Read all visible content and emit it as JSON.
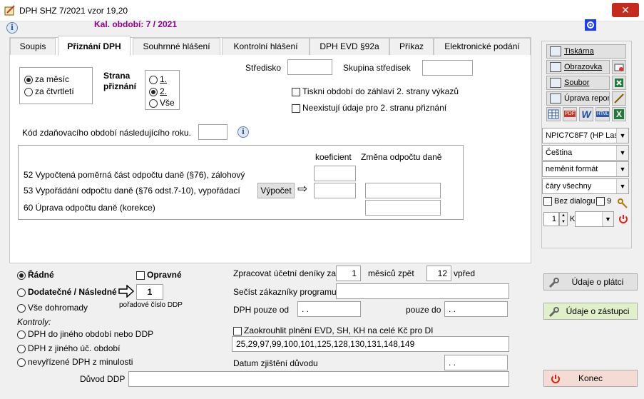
{
  "window": {
    "title": "DPH SHZ  7/2021 vzor 19,20",
    "close_glyph": "✕",
    "period": "Kal. období: 7 / 2021"
  },
  "tabs": [
    {
      "label": "Soupis"
    },
    {
      "label": "Přiznání DPH"
    },
    {
      "label": "Souhrnné hlášení"
    },
    {
      "label": "Kontrolní hlášení"
    },
    {
      "label": "DPH EVD §92a"
    },
    {
      "label": "Příkaz"
    },
    {
      "label": "Elektronické podání"
    }
  ],
  "period_type": {
    "monthly": "za měsíc",
    "quarterly": "za čtvrtletí"
  },
  "strana": {
    "title_1": "Strana",
    "title_2": "přiznání",
    "opt1": "1.",
    "opt2": "2.",
    "opt_all": "Vše"
  },
  "stredisko": {
    "label": "Středisko",
    "value": ""
  },
  "skupina": {
    "label": "Skupina středisek",
    "value": ""
  },
  "checks": {
    "tiskni": "Tiskni období do záhlaví 2. strany výkazů",
    "neexistuji": "Neexistují údaje pro 2. stranu přiznání"
  },
  "kod": {
    "label": "Kód zdaňovacího období následujícího roku.",
    "value": ""
  },
  "odpocet": {
    "col_koef": "koeficient",
    "col_zmena": "Změna odpočtu daně",
    "row52": "52 Vypočtená poměrná část odpočtu daně (§76), zálohový",
    "row53": "53 Vypořádání odpočtu daně (§76 odst.7-10), vypořádací",
    "row60": "60 Úprava odpočtu daně (korekce)",
    "vypocet": "Výpočet",
    "arrow": "⇨"
  },
  "side": {
    "tiskarna": "Tiskárna",
    "obrazovka": "Obrazovka",
    "soubor": "Soubor",
    "uprava": "Úprava repor",
    "icons": [
      "PDF",
      "W",
      "HTML",
      "X"
    ],
    "printer": "NPIC7C8F7 (HP Lase",
    "language": "Čeština",
    "format": "neměnit formát",
    "lines": "čáry všechny",
    "bez_dialogu": "Bez dialogu",
    "nine": "9",
    "copies": "1",
    "k": "K",
    "combo_arrow": "▼"
  },
  "type": {
    "radne": "Řádné",
    "opravne": "Opravné",
    "dodatecne": "Dodatečné / Následné",
    "poradove_value": "1",
    "poradove_label": "pořadové číslo DDP",
    "vse_dohromady": "Vše dohromady",
    "kontroly": "Kontroly:",
    "k1": "DPH do jiného období nebo DDP",
    "k2": "DPH z jiného úč. období",
    "k3": "nevyřízené DPH z minulosti"
  },
  "processing": {
    "zpracovat_label": "Zpracovat účetní deníky za",
    "months_back": "1",
    "mesicu_zpet": "měsíců zpět",
    "months_fwd": "12",
    "vpred": "vpřed",
    "secist": "Sečíst zákazníky programu",
    "dph_od": "DPH pouze od",
    "dph_od_value": ". .",
    "pouze_do": "pouze do",
    "pouze_do_value": ". .",
    "zaokrouhlit": "Zaokrouhlit plnění EVD, SH, KH na celé Kč pro DI",
    "codes": "25,29,97,99,100,101,125,128,130,131,148,149",
    "datum": "Datum zjištění důvodu",
    "datum_value": ". .",
    "duvod": "Důvod DDP"
  },
  "buttons": {
    "udaje_platci": "Údaje o plátci",
    "udaje_zastupci": "Údaje o zástupci",
    "konec": "Konec"
  }
}
